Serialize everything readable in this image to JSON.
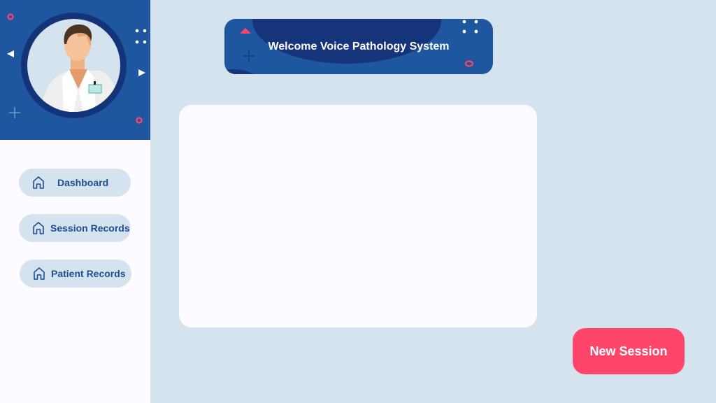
{
  "theme": {
    "primary": "#1e56a0",
    "primary_dark": "#14347a",
    "background": "#d5e3ee",
    "surface": "#fdfbff",
    "accent": "#ff4569",
    "nav_text": "#1d4f91"
  },
  "sidebar": {
    "avatar_icon": "doctor-avatar",
    "items": [
      {
        "label": "Dashboard",
        "icon": "home-icon"
      },
      {
        "label": "Session Records",
        "icon": "home-icon"
      },
      {
        "label": "Patient Records",
        "icon": "home-icon"
      }
    ]
  },
  "header": {
    "title": "Welcome Voice Pathology System"
  },
  "actions": {
    "new_session_label": "New Session"
  }
}
